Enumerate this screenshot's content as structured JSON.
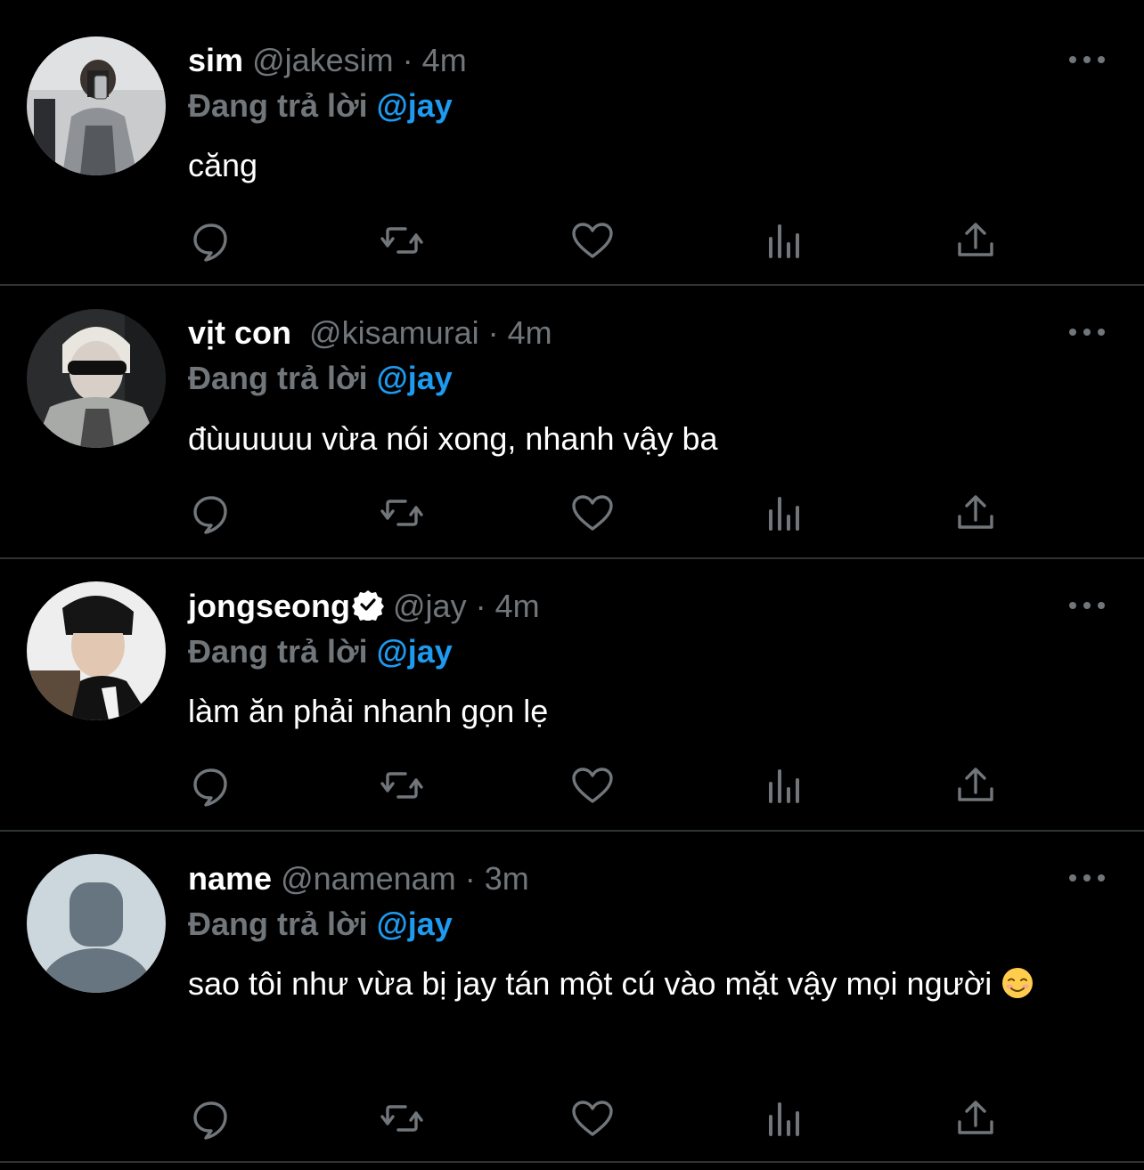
{
  "colors": {
    "background": "#000000",
    "divider": "#2f3336",
    "name_text": "#ffffff",
    "muted_text": "#71767b",
    "mention_blue": "#1d9bf0",
    "icon_gray": "#71767b"
  },
  "replying_label": "Đang trả lời",
  "tweets": [
    {
      "name": "sim",
      "verified": false,
      "handle": "@jakesim",
      "separator": "·",
      "time": "4m",
      "reply_to": "@jay",
      "text": "căng",
      "avatar": "photo"
    },
    {
      "name": "vịt con",
      "verified": false,
      "handle": "@kisamurai",
      "separator": "·",
      "time": "4m",
      "reply_to": "@jay",
      "text": "đùuuuuu vừa nói xong, nhanh vậy ba",
      "avatar": "photo"
    },
    {
      "name": "jongseong",
      "verified": true,
      "handle": "@jay",
      "separator": "·",
      "time": "4m",
      "reply_to": "@jay",
      "text": "làm ăn phải nhanh gọn lẹ",
      "avatar": "photo"
    },
    {
      "name": "name",
      "verified": false,
      "handle": "@namenam",
      "separator": "·",
      "time": "3m",
      "reply_to": "@jay",
      "text": "sao tôi như vừa bị jay tán một cú vào mặt vậy mọi người",
      "emoji": "smiling-face-emoji",
      "avatar": "default-placeholder"
    }
  ],
  "action_icons": [
    "reply-icon",
    "retweet-icon",
    "like-icon",
    "views-icon",
    "share-icon"
  ],
  "more_icon": "more-options-icon"
}
